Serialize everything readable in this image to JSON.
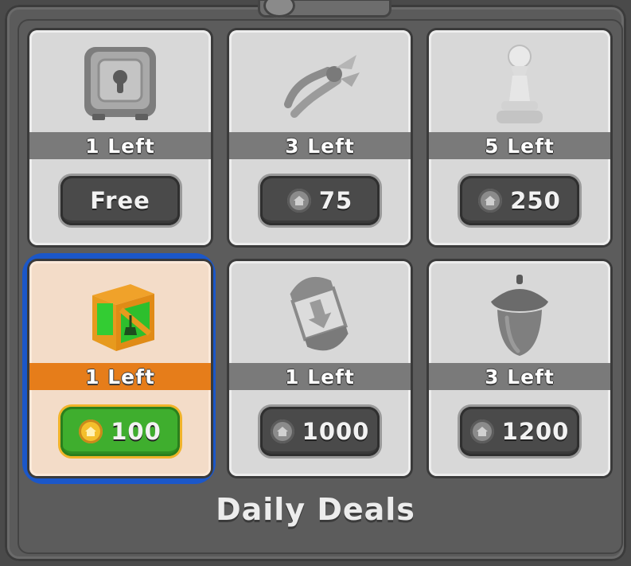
{
  "panel": {
    "title": "Daily Deals"
  },
  "deals": [
    {
      "item_icon": "safe-icon",
      "stock": "1 Left",
      "price": "Free",
      "currency_icon": null,
      "selected": false
    },
    {
      "item_icon": "pliers-icon",
      "stock": "3 Left",
      "price": "75",
      "currency_icon": "coin-icon",
      "selected": false
    },
    {
      "item_icon": "pawn-icon",
      "stock": "5 Left",
      "price": "250",
      "currency_icon": "coin-icon",
      "selected": false
    },
    {
      "item_icon": "crate-icon",
      "stock": "1 Left",
      "price": "100",
      "currency_icon": "coin-icon",
      "selected": true
    },
    {
      "item_icon": "capsule-icon",
      "stock": "1 Left",
      "price": "1000",
      "currency_icon": "coin-icon",
      "selected": false
    },
    {
      "item_icon": "acorn-icon",
      "stock": "3 Left",
      "price": "1200",
      "currency_icon": "coin-icon",
      "selected": false
    }
  ],
  "colors": {
    "selected_band": "#e67d1a",
    "selected_button": "#3fae2e",
    "highlight": "#1b57c9"
  }
}
